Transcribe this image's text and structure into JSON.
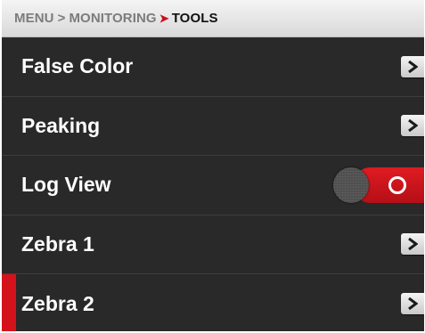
{
  "breadcrumb": {
    "items": [
      "MENU",
      "MONITORING",
      "TOOLS"
    ],
    "separator": ">"
  },
  "menu": {
    "items": [
      {
        "label": "False Color",
        "control": "arrow"
      },
      {
        "label": "Peaking",
        "control": "arrow"
      },
      {
        "label": "Log View",
        "control": "toggle",
        "toggle_state": "on"
      },
      {
        "label": "Zebra 1",
        "control": "arrow"
      },
      {
        "label": "Zebra 2",
        "control": "arrow",
        "selected": true
      }
    ]
  },
  "colors": {
    "accent": "#d4121c",
    "background": "#262626",
    "header": "#e6e6e6"
  },
  "icons": {
    "arrow": "chevron-right-icon",
    "toggle": "toggle-switch"
  }
}
